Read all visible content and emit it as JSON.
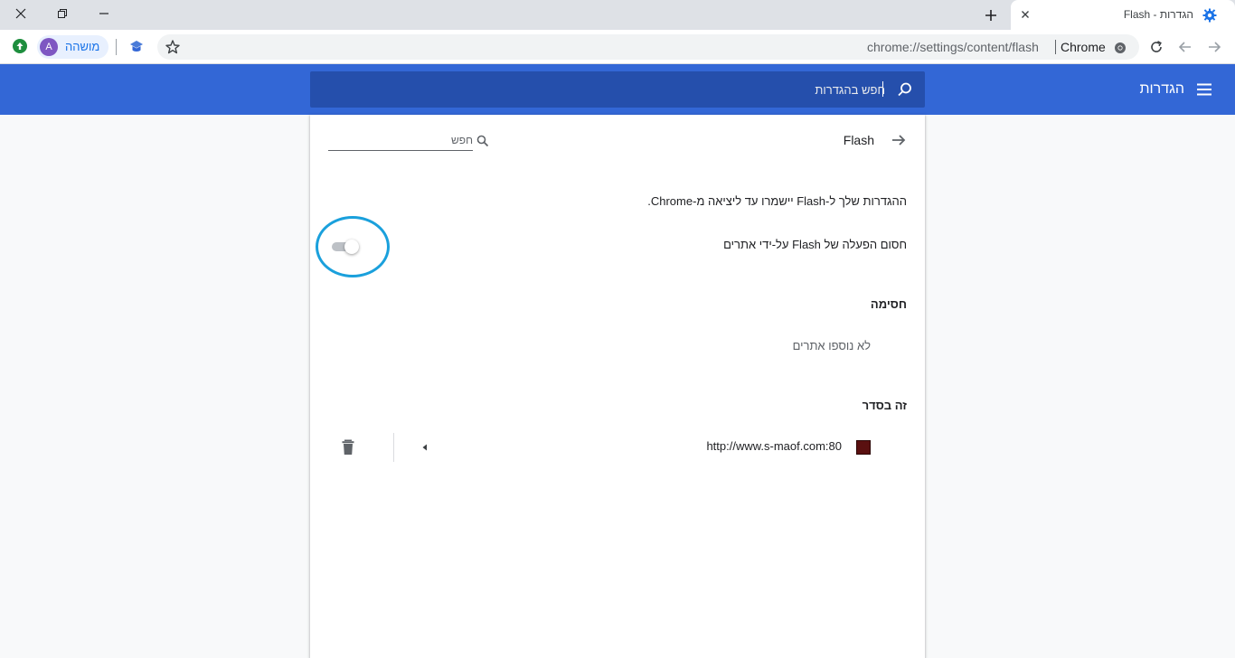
{
  "browser": {
    "tab": {
      "title": "הגדרות - Flash"
    },
    "toolbar": {
      "profile_name": "מושהה",
      "avatar_letter": "A",
      "url_host": "chrome://settings/content/flash",
      "url_chip": "Chrome"
    }
  },
  "settings": {
    "header_title": "הגדרות",
    "search_placeholder": "חפש בהגדרות"
  },
  "page": {
    "title": "Flash",
    "search_placeholder": "חפש",
    "notice": "ההגדרות שלך ל-Flash יישמרו עד ליציאה מ-Chrome.",
    "toggle_label": "חסום הפעלה של Flash על-ידי אתרים",
    "toggle_on": false,
    "blocked_section": {
      "heading": "חסימה",
      "empty_text": "לא נוספו אתרים"
    },
    "allowed_section": {
      "heading": "זה בסדר",
      "sites": [
        {
          "url": "http://www.s-maof.com:80"
        }
      ]
    }
  },
  "colors": {
    "header_bg": "#3367d6",
    "search_bg": "#254fac",
    "highlight_ring": "#1aa0dc",
    "profile_accent": "#1a73e8"
  }
}
